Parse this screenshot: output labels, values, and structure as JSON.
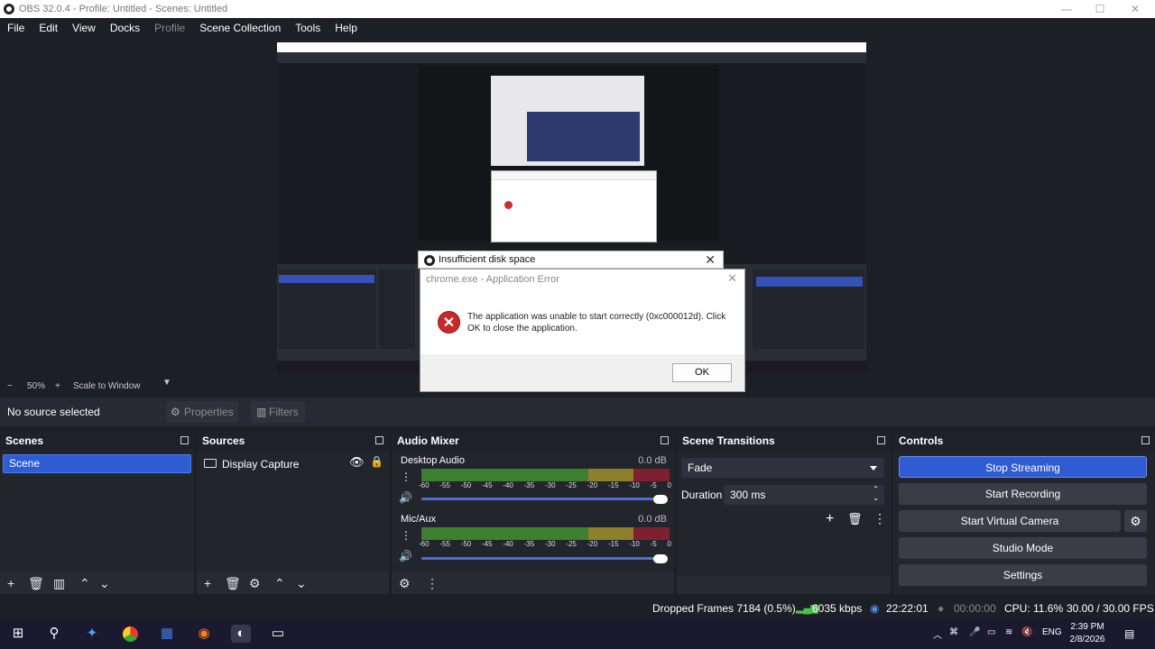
{
  "window": {
    "title": "OBS 32.0.4 - Profile: Untitled - Scenes: Untitled",
    "minimize": "—",
    "maximize": "☐",
    "close": "✕"
  },
  "menu": [
    "File",
    "Edit",
    "View",
    "Docks",
    "Profile",
    "Scene Collection",
    "Tools",
    "Help"
  ],
  "dialog_outer": {
    "title": "Insufficient disk space",
    "close": "✕"
  },
  "dialog": {
    "title": "chrome.exe - Application Error",
    "close": "✕",
    "message": "The application was unable to start correctly (0xc000012d). Click OK to close the application.",
    "ok_label": "OK"
  },
  "preview_toolbar": {
    "minus": "−",
    "zoom": "50%",
    "plus": "+",
    "scale": "Scale to Window"
  },
  "context_bar": {
    "status": "No source selected",
    "properties_label": "Properties",
    "filters_label": "Filters"
  },
  "scenes": {
    "title": "Scenes",
    "items": [
      "Scene"
    ]
  },
  "sources": {
    "title": "Sources",
    "items": [
      "Display Capture"
    ]
  },
  "audio_mixer": {
    "title": "Audio Mixer",
    "channels": [
      {
        "name": "Desktop Audio",
        "db": "0.0 dB"
      },
      {
        "name": "Mic/Aux",
        "db": "0.0 dB"
      }
    ],
    "ticks": [
      "-60",
      "-55",
      "-50",
      "-45",
      "-40",
      "-35",
      "-30",
      "-25",
      "-20",
      "-15",
      "-10",
      "-5",
      "0"
    ]
  },
  "scene_transitions": {
    "title": "Scene Transitions",
    "transition": "Fade",
    "duration_label": "Duration",
    "duration_value": "300 ms"
  },
  "controls": {
    "title": "Controls",
    "stop_streaming": "Stop Streaming",
    "start_recording": "Start Recording",
    "start_virtual_camera": "Start Virtual Camera",
    "studio_mode": "Studio Mode",
    "settings": "Settings"
  },
  "status_bar": {
    "dropped_frames": "Dropped Frames 7184 (0.5%)",
    "bitrate": "6035 kbps",
    "stream_time": "22:22:01",
    "record_time": "00:00:00",
    "cpu": "CPU: 11.6%",
    "fps": "30.00 / 30.00 FPS"
  },
  "taskbar": {
    "language": "ENG",
    "time": "2:39 PM",
    "date": "2/8/2026"
  },
  "colors": {
    "accent_blue": "#2f5bd3",
    "meter_green": "#3c7f2f",
    "meter_yellow": "#8e7f2a",
    "meter_red": "#7e2030",
    "error_red": "#c52a2a"
  }
}
